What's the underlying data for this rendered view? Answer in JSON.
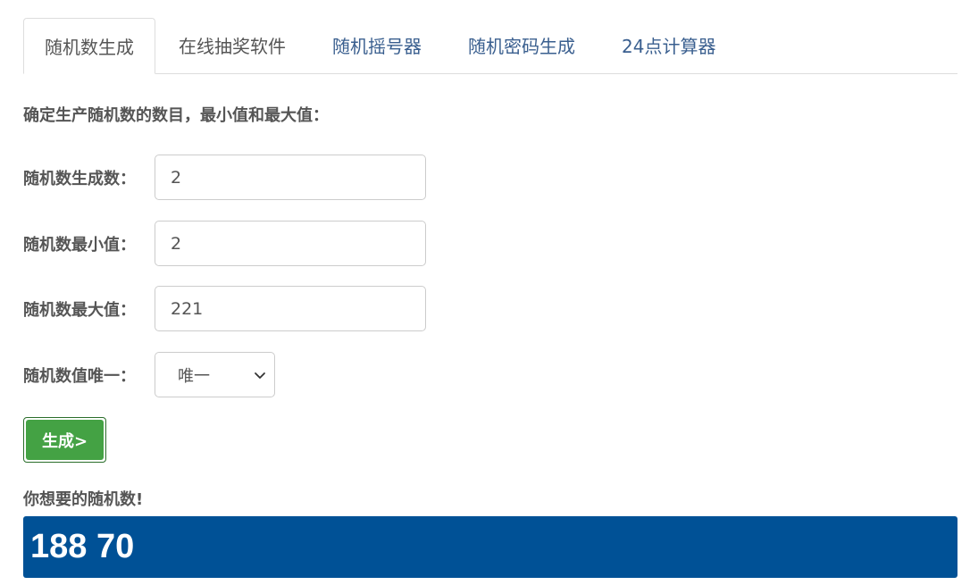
{
  "tabs": [
    {
      "label": "随机数生成"
    },
    {
      "label": "在线抽奖软件"
    },
    {
      "label": "随机摇号器"
    },
    {
      "label": "随机密码生成"
    },
    {
      "label": "24点计算器"
    }
  ],
  "intro": "确定生产随机数的数目，最小值和最大值：",
  "fields": {
    "count": {
      "label": "随机数生成数：",
      "value": "2"
    },
    "min": {
      "label": "随机数最小值：",
      "value": "2"
    },
    "max": {
      "label": "随机数最大值：",
      "value": "221"
    }
  },
  "unique": {
    "label": "随机数值唯一：",
    "selected": "唯一"
  },
  "generate_label": "生成>",
  "result": {
    "label": "你想要的随机数!",
    "value": "188 70"
  },
  "colors": {
    "result_bg": "#005196",
    "button_bg": "#44a244",
    "tab_link": "#3a5f8f"
  },
  "icons": {
    "select_arrow": "chevron-down-icon"
  }
}
